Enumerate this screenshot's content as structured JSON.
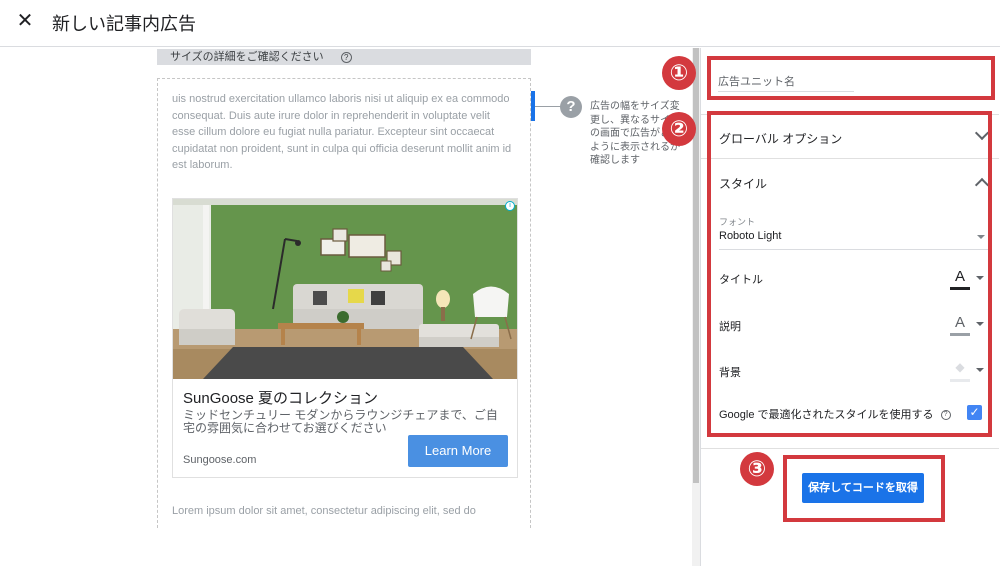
{
  "header": {
    "close_icon": "close-icon",
    "title": "新しい記事内広告"
  },
  "preview": {
    "size_bar_label": "サイズの詳細をご確認ください",
    "size_help_glyph": "?",
    "lorem_top": "uis nostrud exercitation ullamco laboris nisi ut aliquip ex ea commodo consequat. Duis aute irure dolor in reprehenderit in voluptate velit esse cillum dolore eu fugiat nulla pariatur. Excepteur sint occaecat cupidatat non proident, sunt in culpa qui officia deserunt mollit anim id est laborum.",
    "ad": {
      "info_glyph": "i",
      "title": "SunGoose 夏のコレクション",
      "description": "ミッドセンチュリー モダンからラウンジチェアまで、ご自宅の雰囲気に合わせてお選びください",
      "domain": "Sungoose.com",
      "cta": "Learn More"
    },
    "lorem_bottom": "Lorem ipsum dolor sit amet, consectetur adipiscing elit, sed do",
    "resize_help_glyph": "?",
    "resize_tip": "広告の幅をサイズ変更し、異なるサイズの画面で広告がどのように表示されるか確認します"
  },
  "panel": {
    "unit_name_placeholder": "広告ユニット名",
    "global_options_label": "グローバル オプション",
    "style_label": "スタイル",
    "font_caption": "フォント",
    "font_value": "Roboto Light",
    "title_label": "タイトル",
    "description_label": "説明",
    "background_label": "背景",
    "title_color": "#202124",
    "description_color": "#9aa0a6",
    "background_color": "#e8eaed",
    "text_color_glyph": "A",
    "fill_glyph": "◆",
    "google_optimized_label": "Google で最適化されたスタイルを使用する",
    "google_optimized_checked": true,
    "help_glyph": "?",
    "check_glyph": "✓",
    "save_button": "保存してコードを取得"
  },
  "annotations": {
    "num1": "①",
    "num2": "②",
    "num3": "③",
    "accent": "#d3393e"
  }
}
